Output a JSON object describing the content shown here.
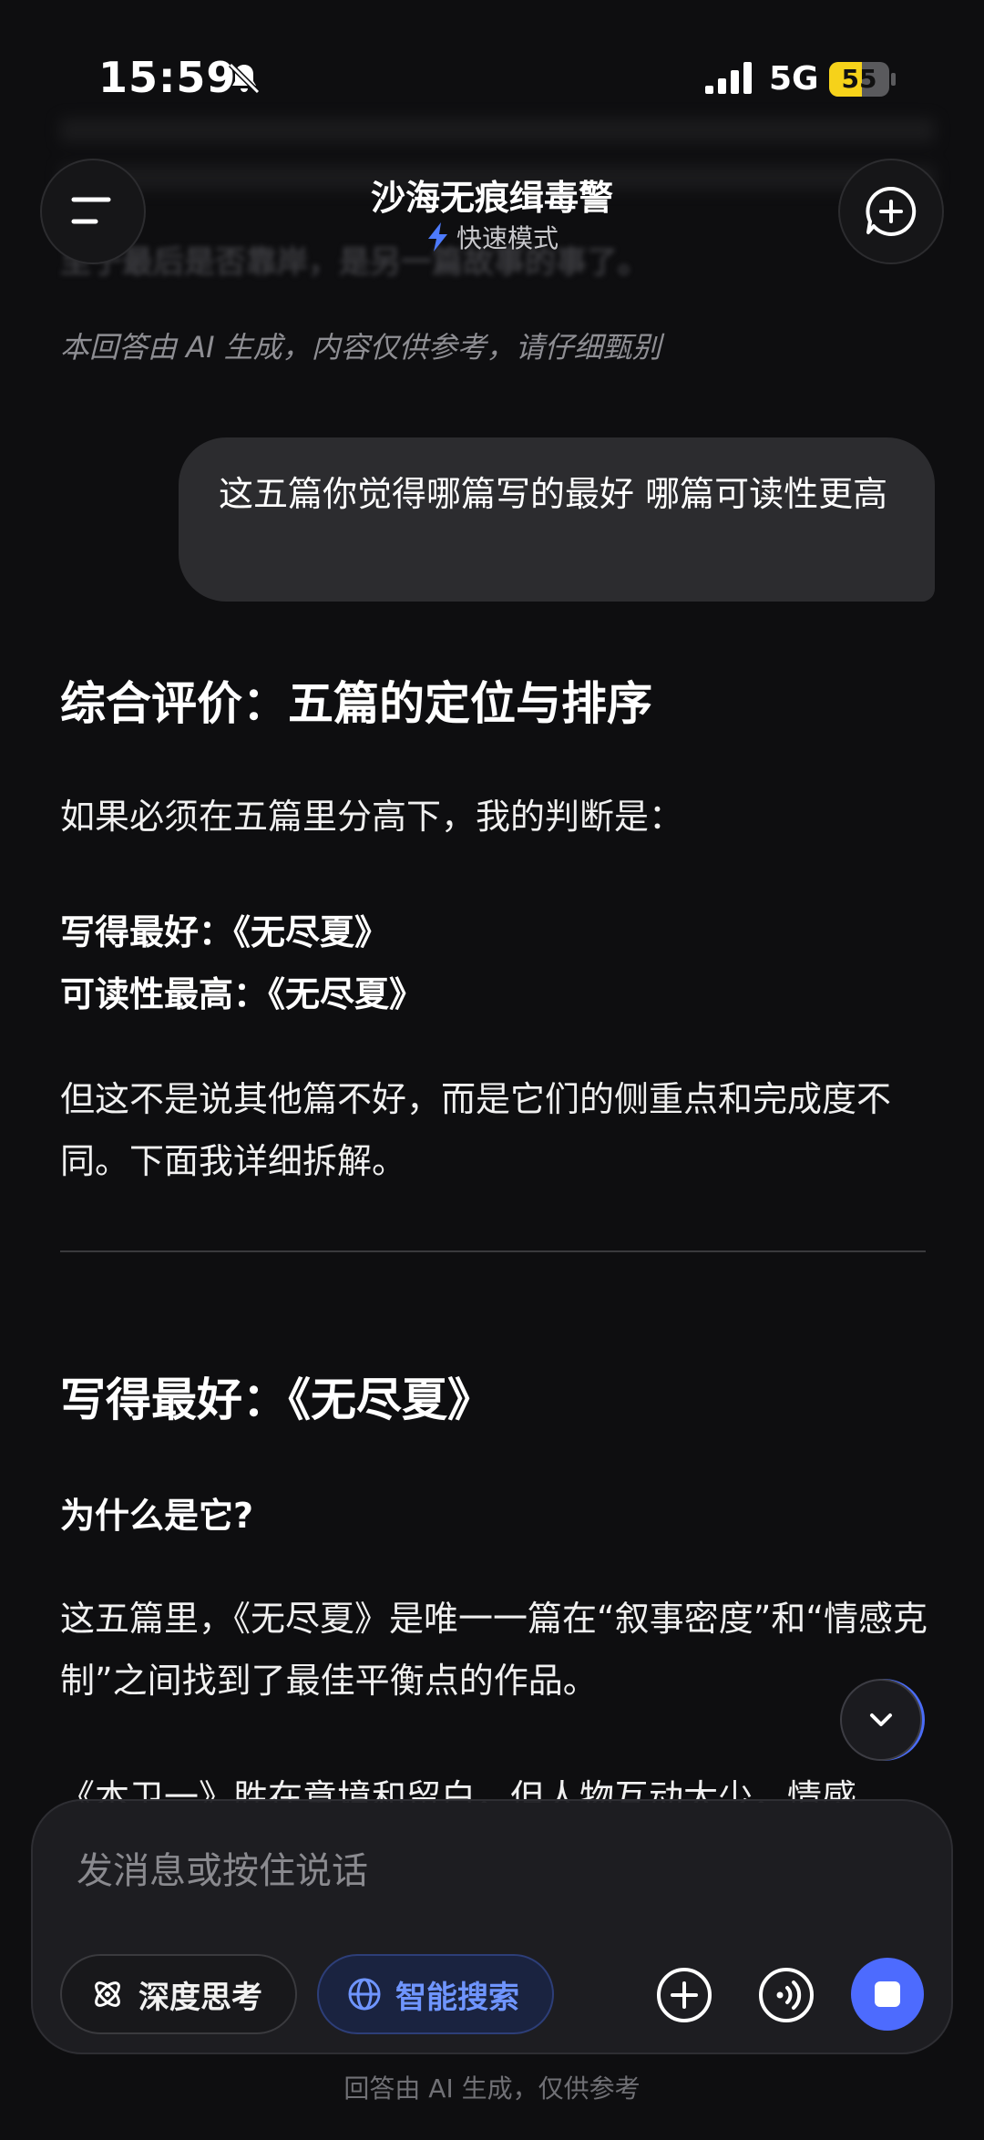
{
  "status_bar": {
    "time": "15:59",
    "network": "5G",
    "battery_level": "55",
    "battery_fraction": 0.55,
    "icons": [
      "bell-off-icon",
      "signal-icon",
      "battery-icon"
    ]
  },
  "header": {
    "title": "沙海无痕缉毒警",
    "mode_label": "快速模式",
    "mode_icon": "lightning-icon",
    "menu_icon": "menu-icon",
    "new_chat_icon": "new-chat-icon"
  },
  "background_text": "至于最后是否靠岸，是另一篇故事的事了。",
  "disclaimer": "本回答由 AI 生成，内容仅供参考，请仔细甄别",
  "user_message": "这五篇你觉得哪篇写的最好 哪篇可读性更高",
  "answer": {
    "heading": "综合评价：五篇的定位与排序",
    "intro": "如果必须在五篇里分高下，我的判断是：",
    "best_written": "写得最好：《无尽夏》",
    "most_readable": "可读性最高：《无尽夏》",
    "note": "但这不是说其他篇不好，而是它们的侧重点和完成度不同。下面我详细拆解。",
    "section_heading": "写得最好：《无尽夏》",
    "question": "为什么是它?",
    "reason": "这五篇里，《无尽夏》是唯一一篇在“叙事密度”和“情感克制”之间找到了最佳平衡点的作品。",
    "partial_line": "《本卫一》胜在意境和留白，但人物互动太少，情感"
  },
  "composer": {
    "placeholder": "发消息或按住说话",
    "deep_think_label": "深度思考",
    "smart_search_label": "智能搜索",
    "accent_color": "#4d6bfe"
  },
  "footer_note": "回答由 AI 生成，仅供参考"
}
